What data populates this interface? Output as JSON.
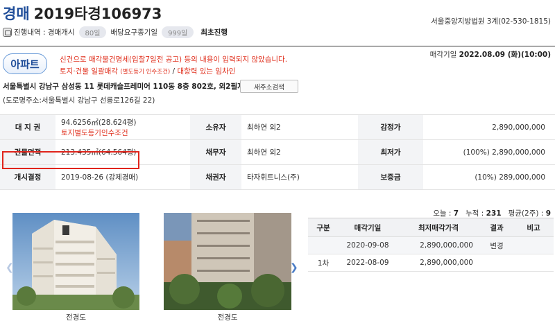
{
  "header": {
    "type_label": "경매",
    "case_number": "2019타경106973",
    "court": "서울중앙지방법원 3계(02-530-1815)"
  },
  "progress": {
    "label": "진행내역 : 경매개시",
    "days1": "80일",
    "label2": "배당요구종기일",
    "days2": "999일",
    "status": "최초진행"
  },
  "property_type": "아파트",
  "notices": {
    "line1": "신건으로 매각물건명세(입찰7일전 공고) 등의 내용이 입력되지 않았습니다.",
    "line2_a": "토지·건물 일괄매각",
    "line2_b": "(별도등기 인수조건)",
    "line2_c": " / ",
    "line2_d": "대항력 있는 임차인"
  },
  "sale_date": {
    "label": "매각기일",
    "value": "2022.08.09 (화)(10:00)"
  },
  "address": {
    "main": "서울특별시 강남구 삼성동 11 롯데캐슬프레미어 110동 8층 802호, 외2필지",
    "button": "새주소검색",
    "road": "(도로명주소:서울특별시 강남구 선릉로126길 22)"
  },
  "info": {
    "land_label": "대 지 권",
    "land_value": "94.6256㎡(28.624평)",
    "land_note": "토지별도등기인수조건",
    "owner_label": "소유자",
    "owner_value": "최하연 외2",
    "appraisal_label": "감정가",
    "appraisal_value": "2,890,000,000",
    "building_label": "건물면적",
    "building_value": "213.435㎡(64.564평)",
    "debtor_label": "채무자",
    "debtor_value": "최하연 외2",
    "min_label": "최저가",
    "min_value": "(100%) 2,890,000,000",
    "start_label": "개시결정",
    "start_value": "2019-08-26 (강제경매)",
    "creditor_label": "채권자",
    "creditor_value": "타자휘트니스(주)",
    "deposit_label": "보증금",
    "deposit_value": "(10%) 289,000,000"
  },
  "stats": {
    "today_label": "오늘 :",
    "today": "7",
    "total_label": "누적 :",
    "total": "231",
    "avg_label": "평균(2주) :",
    "avg": "9"
  },
  "photos": {
    "caption1": "전경도",
    "caption2": "전경도"
  },
  "history": {
    "headers": [
      "구분",
      "매각기일",
      "최저매각가격",
      "결과",
      "비고"
    ],
    "rows": [
      {
        "round": "",
        "date": "2020-09-08",
        "price": "2,890,000,000",
        "result": "변경",
        "note": ""
      },
      {
        "round": "1차",
        "date": "2022-08-09",
        "price": "2,890,000,000",
        "result": "",
        "note": ""
      }
    ]
  }
}
